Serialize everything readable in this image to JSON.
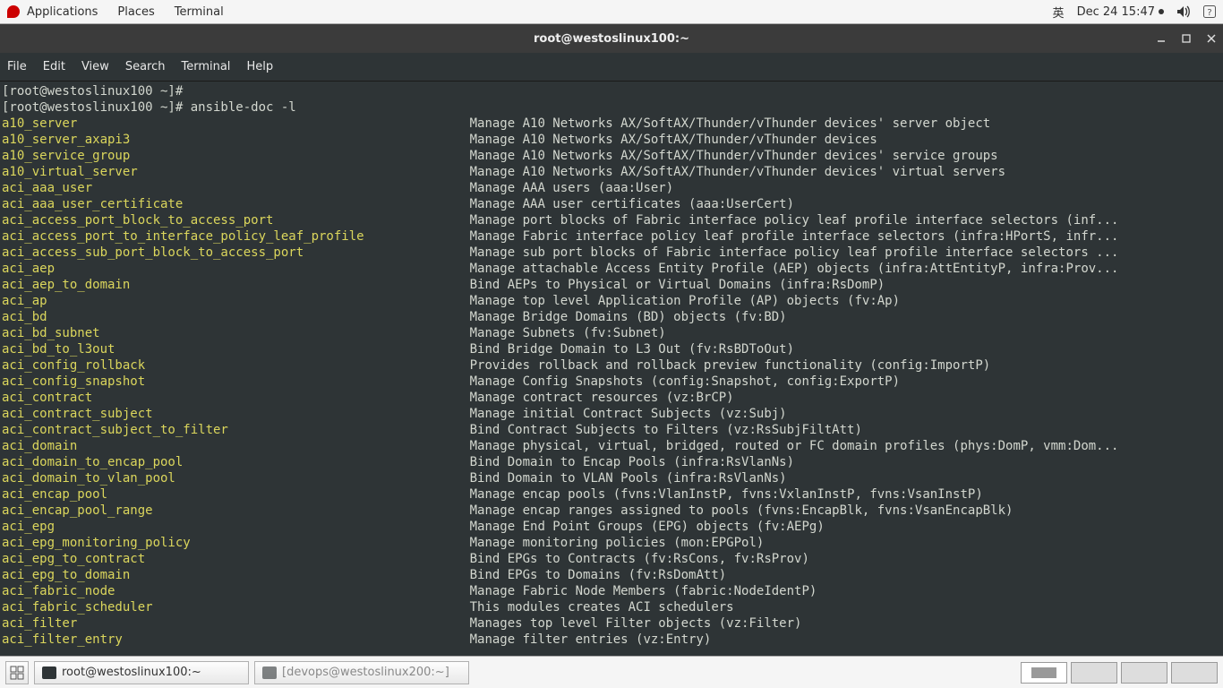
{
  "top_panel": {
    "applications": "Applications",
    "places": "Places",
    "terminal": "Terminal",
    "ime": "英",
    "datetime": "Dec 24  15:47"
  },
  "window": {
    "title": "root@westoslinux100:~"
  },
  "menubar": {
    "file": "File",
    "edit": "Edit",
    "view": "View",
    "search": "Search",
    "terminal": "Terminal",
    "help": "Help"
  },
  "terminal": {
    "prompt1": "[root@westoslinux100 ~]# ",
    "prompt2": "[root@westoslinux100 ~]# ",
    "cmd": "ansible-doc -l",
    "modules": [
      {
        "n": "a10_server",
        "d": "Manage A10 Networks AX/SoftAX/Thunder/vThunder devices' server object"
      },
      {
        "n": "a10_server_axapi3",
        "d": "Manage A10 Networks AX/SoftAX/Thunder/vThunder devices"
      },
      {
        "n": "a10_service_group",
        "d": "Manage A10 Networks AX/SoftAX/Thunder/vThunder devices' service groups"
      },
      {
        "n": "a10_virtual_server",
        "d": "Manage A10 Networks AX/SoftAX/Thunder/vThunder devices' virtual servers"
      },
      {
        "n": "aci_aaa_user",
        "d": "Manage AAA users (aaa:User)"
      },
      {
        "n": "aci_aaa_user_certificate",
        "d": "Manage AAA user certificates (aaa:UserCert)"
      },
      {
        "n": "aci_access_port_block_to_access_port",
        "d": "Manage port blocks of Fabric interface policy leaf profile interface selectors (inf..."
      },
      {
        "n": "aci_access_port_to_interface_policy_leaf_profile",
        "d": "Manage Fabric interface policy leaf profile interface selectors (infra:HPortS, infr..."
      },
      {
        "n": "aci_access_sub_port_block_to_access_port",
        "d": "Manage sub port blocks of Fabric interface policy leaf profile interface selectors ..."
      },
      {
        "n": "aci_aep",
        "d": "Manage attachable Access Entity Profile (AEP) objects (infra:AttEntityP, infra:Prov..."
      },
      {
        "n": "aci_aep_to_domain",
        "d": "Bind AEPs to Physical or Virtual Domains (infra:RsDomP)"
      },
      {
        "n": "aci_ap",
        "d": "Manage top level Application Profile (AP) objects (fv:Ap)"
      },
      {
        "n": "aci_bd",
        "d": "Manage Bridge Domains (BD) objects (fv:BD)"
      },
      {
        "n": "aci_bd_subnet",
        "d": "Manage Subnets (fv:Subnet)"
      },
      {
        "n": "aci_bd_to_l3out",
        "d": "Bind Bridge Domain to L3 Out (fv:RsBDToOut)"
      },
      {
        "n": "aci_config_rollback",
        "d": "Provides rollback and rollback preview functionality (config:ImportP)"
      },
      {
        "n": "aci_config_snapshot",
        "d": "Manage Config Snapshots (config:Snapshot, config:ExportP)"
      },
      {
        "n": "aci_contract",
        "d": "Manage contract resources (vz:BrCP)"
      },
      {
        "n": "aci_contract_subject",
        "d": "Manage initial Contract Subjects (vz:Subj)"
      },
      {
        "n": "aci_contract_subject_to_filter",
        "d": "Bind Contract Subjects to Filters (vz:RsSubjFiltAtt)"
      },
      {
        "n": "aci_domain",
        "d": "Manage physical, virtual, bridged, routed or FC domain profiles (phys:DomP, vmm:Dom..."
      },
      {
        "n": "aci_domain_to_encap_pool",
        "d": "Bind Domain to Encap Pools (infra:RsVlanNs)"
      },
      {
        "n": "aci_domain_to_vlan_pool",
        "d": "Bind Domain to VLAN Pools (infra:RsVlanNs)"
      },
      {
        "n": "aci_encap_pool",
        "d": "Manage encap pools (fvns:VlanInstP, fvns:VxlanInstP, fvns:VsanInstP)"
      },
      {
        "n": "aci_encap_pool_range",
        "d": "Manage encap ranges assigned to pools (fvns:EncapBlk, fvns:VsanEncapBlk)"
      },
      {
        "n": "aci_epg",
        "d": "Manage End Point Groups (EPG) objects (fv:AEPg)"
      },
      {
        "n": "aci_epg_monitoring_policy",
        "d": "Manage monitoring policies (mon:EPGPol)"
      },
      {
        "n": "aci_epg_to_contract",
        "d": "Bind EPGs to Contracts (fv:RsCons, fv:RsProv)"
      },
      {
        "n": "aci_epg_to_domain",
        "d": "Bind EPGs to Domains (fv:RsDomAtt)"
      },
      {
        "n": "aci_fabric_node",
        "d": "Manage Fabric Node Members (fabric:NodeIdentP)"
      },
      {
        "n": "aci_fabric_scheduler",
        "d": "This modules creates ACI schedulers"
      },
      {
        "n": "aci_filter",
        "d": "Manages top level Filter objects (vz:Filter)"
      },
      {
        "n": "aci_filter_entry",
        "d": "Manage filter entries (vz:Entry)"
      }
    ]
  },
  "taskbar": {
    "task1": "root@westoslinux100:~",
    "task2": "[devops@westoslinux200:~]"
  }
}
